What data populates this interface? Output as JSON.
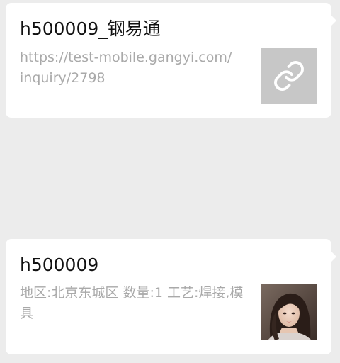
{
  "messages": [
    {
      "title": "h500009_钢易通",
      "description": "https://test-mobile.gangyi.com/inquiry/2798",
      "thumbnail": "link-icon"
    },
    {
      "title": "h500009",
      "description": "地区:北京东城区 数量:1 工艺:焊接,模具",
      "thumbnail": "avatar"
    }
  ],
  "colors": {
    "background": "#ececec",
    "bubble": "#ffffff",
    "title": "#111111",
    "description": "#a9a9a9",
    "link_thumb_bg": "#c7c7c7"
  }
}
